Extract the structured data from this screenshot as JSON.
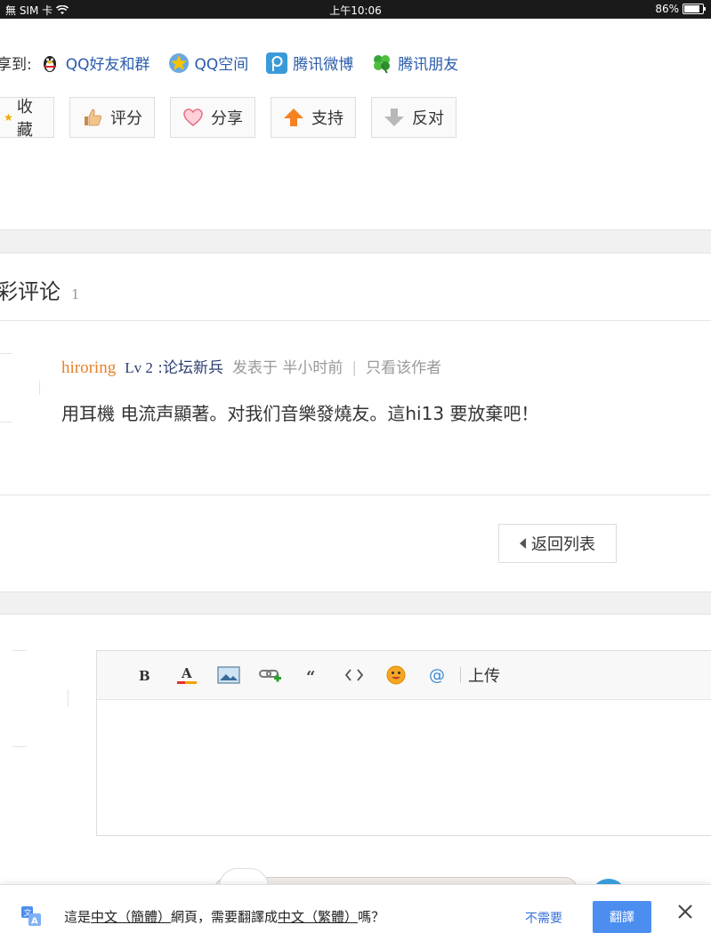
{
  "status_bar": {
    "carrier": "無 SIM 卡",
    "time": "上午10:06",
    "battery": "86%",
    "battery_level": 0.86
  },
  "share": {
    "label": "享到:",
    "items": [
      {
        "label": "QQ好友和群",
        "icon": "qq-penguin-icon"
      },
      {
        "label": "QQ空间",
        "icon": "qzone-star-icon"
      },
      {
        "label": "腾讯微博",
        "icon": "tencent-weibo-icon"
      },
      {
        "label": "腾讯朋友",
        "icon": "clover-icon"
      }
    ]
  },
  "actions": [
    {
      "label": "收藏",
      "icon": "star-icon"
    },
    {
      "label": "评分",
      "icon": "thumbs-up-icon"
    },
    {
      "label": "分享",
      "icon": "heart-icon"
    },
    {
      "label": "支持",
      "icon": "arrow-up-icon"
    },
    {
      "label": "反对",
      "icon": "arrow-down-icon"
    }
  ],
  "comments_section": {
    "title": "彩评论",
    "count": "1"
  },
  "comment": {
    "username": "hiroring",
    "level": "Lv 2",
    "rank": ":论坛新兵",
    "posted": "发表于 半小时前",
    "separator": "|",
    "author_only": "只看该作者",
    "body": "用耳機 电流声顯著。对我们音樂發燒友。這hi13 要放棄吧！"
  },
  "back_button": {
    "label": "返回列表"
  },
  "editor": {
    "upload_label": "上传"
  },
  "translate_bar": {
    "prefix": "這是",
    "source_lang": "中文（簡體）",
    "middle": "網頁，需要翻譯成",
    "target_lang": "中文（繁體）",
    "suffix": "嗎？",
    "no_label": "不需要",
    "yes_label": "翻譯"
  },
  "colors": {
    "link": "#2a5caa",
    "username": "#e8802a",
    "translate_button": "#4c8ef0"
  }
}
